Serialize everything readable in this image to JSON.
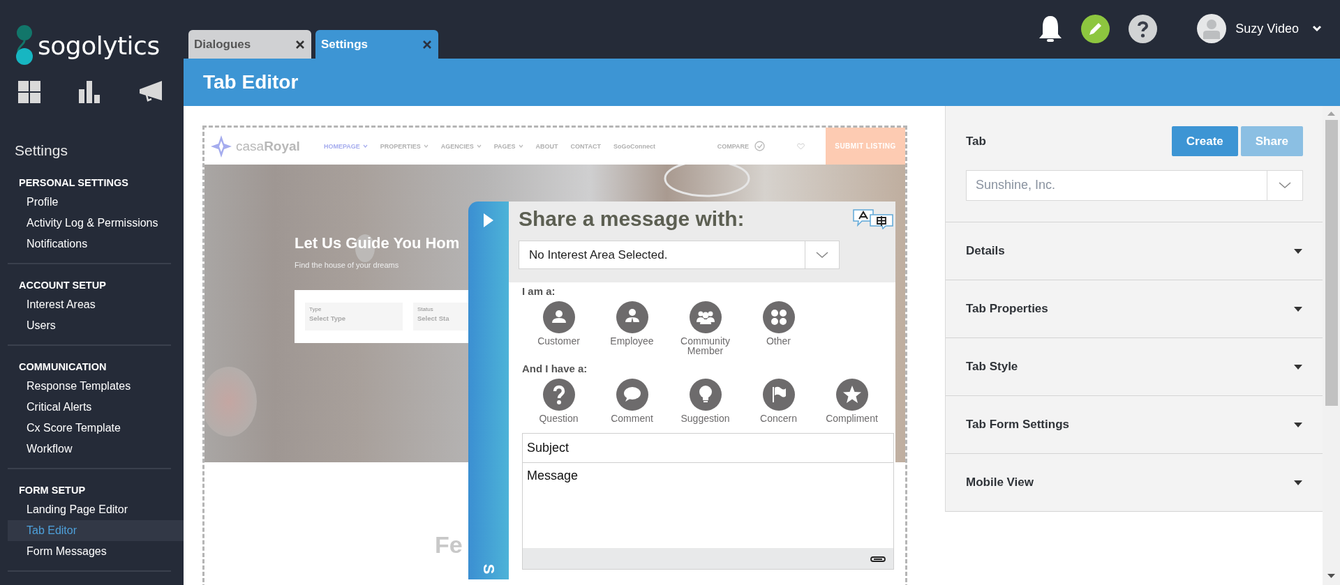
{
  "brand": {
    "name": "sogolytics"
  },
  "sidebar": {
    "title": "Settings",
    "sections": [
      {
        "heading": "PERSONAL SETTINGS",
        "items": [
          {
            "label": "Profile",
            "selected": false
          },
          {
            "label": "Activity Log & Permissions",
            "selected": false
          },
          {
            "label": "Notifications",
            "selected": false
          }
        ]
      },
      {
        "heading": "ACCOUNT SETUP",
        "items": [
          {
            "label": "Interest Areas",
            "selected": false
          },
          {
            "label": "Users",
            "selected": false
          }
        ]
      },
      {
        "heading": "COMMUNICATION",
        "items": [
          {
            "label": "Response Templates",
            "selected": false
          },
          {
            "label": "Critical Alerts",
            "selected": false
          },
          {
            "label": "Cx Score Template",
            "selected": false
          },
          {
            "label": "Workflow",
            "selected": false
          }
        ]
      },
      {
        "heading": "FORM SETUP",
        "items": [
          {
            "label": "Landing Page Editor",
            "selected": false
          },
          {
            "label": "Tab Editor",
            "selected": true
          },
          {
            "label": "Form Messages",
            "selected": false
          }
        ]
      }
    ]
  },
  "tabs": [
    {
      "label": "Dialogues",
      "selected": false
    },
    {
      "label": "Settings",
      "selected": true
    }
  ],
  "user": {
    "name": "Suzy Video"
  },
  "page_title": "Tab Editor",
  "preview": {
    "site": {
      "logo": "casa**Royal**",
      "nav": [
        {
          "label": "HOMEPAGE",
          "dropdown": true,
          "selected": true
        },
        {
          "label": "PROPERTIES",
          "dropdown": true,
          "selected": false
        },
        {
          "label": "AGENCIES",
          "dropdown": true,
          "selected": false
        },
        {
          "label": "PAGES",
          "dropdown": true,
          "selected": false
        },
        {
          "label": "ABOUT",
          "dropdown": false,
          "selected": false
        },
        {
          "label": "CONTACT",
          "dropdown": false,
          "selected": false
        },
        {
          "label": "SoGoConnect",
          "dropdown": false,
          "selected": false
        }
      ],
      "compare": "COMPARE",
      "submit": "SUBMIT LISTING",
      "hero_title": "Let Us Guide You Hom",
      "hero_subtitle": "Find the house of your dreams",
      "search_fields": [
        {
          "label": "Type",
          "value": "Select Type"
        },
        {
          "label": "Status",
          "value": "Select Sta"
        }
      ],
      "section_heading": "Fe"
    },
    "widget": {
      "side_tab": "S",
      "title": "Share a message with:",
      "interest_area": "No Interest Area Selected.",
      "role_label": "I am a:",
      "roles": [
        {
          "label": "Customer",
          "kind": "person"
        },
        {
          "label": "Employee",
          "kind": "employee"
        },
        {
          "label": "Community Member",
          "kind": "group"
        },
        {
          "label": "Other",
          "kind": "other"
        }
      ],
      "type_label": "And I have a:",
      "types": [
        {
          "label": "Question",
          "kind": "question"
        },
        {
          "label": "Comment",
          "kind": "comment"
        },
        {
          "label": "Suggestion",
          "kind": "suggestion"
        },
        {
          "label": "Concern",
          "kind": "concern"
        },
        {
          "label": "Compliment",
          "kind": "compliment"
        }
      ],
      "subject_placeholder": "Subject",
      "message_placeholder": "Message"
    }
  },
  "panel": {
    "title": "Tab",
    "buttons": [
      {
        "label": "Create",
        "disabled": false
      },
      {
        "label": "Share",
        "disabled": true
      }
    ],
    "select_value": "Sunshine, Inc.",
    "sections": [
      {
        "label": "Details",
        "expanded": false
      },
      {
        "label": "Tab Properties",
        "expanded": false
      },
      {
        "label": "Tab Style",
        "expanded": false
      },
      {
        "label": "Tab Form Settings",
        "expanded": false
      },
      {
        "label": "Mobile View",
        "expanded": false
      }
    ]
  }
}
